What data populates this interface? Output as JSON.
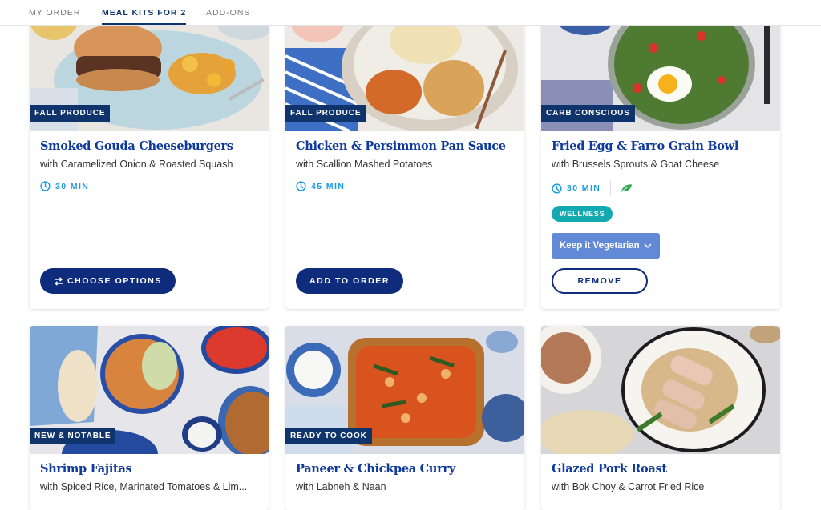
{
  "nav": {
    "tabs": [
      {
        "label": "MY ORDER",
        "active": false
      },
      {
        "label": "MEAL KITS FOR 2",
        "active": true
      },
      {
        "label": "ADD-ONS",
        "active": false
      }
    ]
  },
  "colors": {
    "navy": "#0f2c7c",
    "title_blue": "#0f3a9c",
    "time_blue": "#1f9be0",
    "wellness_teal": "#12aab0",
    "select_blue": "#6189d6"
  },
  "recipes": [
    {
      "tag": "FALL PRODUCE",
      "title": "Smoked Gouda Cheeseburgers",
      "subtitle": "with Caramelized Onion & Roasted Squash",
      "time": "30 MIN",
      "action": "CHOOSE OPTIONS",
      "action_icon": "swap-arrows-icon"
    },
    {
      "tag": "FALL PRODUCE",
      "title": "Chicken & Persimmon Pan Sauce",
      "subtitle": "with Scallion Mashed Potatoes",
      "time": "45 MIN",
      "action": "ADD TO ORDER"
    },
    {
      "tag": "CARB CONSCIOUS",
      "title": "Fried Egg & Farro Grain Bowl",
      "subtitle": "with Brussels Sprouts & Goat Cheese",
      "time": "30 MIN",
      "vegetarian_icon": "leaf-icon",
      "badge": "WELLNESS",
      "option_select": "Keep it Vegetarian",
      "action": "REMOVE",
      "selected": true
    },
    {
      "tag": "NEW & NOTABLE",
      "title": "Shrimp Fajitas",
      "subtitle": "with Spiced Rice, Marinated Tomatoes & Lim..."
    },
    {
      "tag": "READY TO COOK",
      "title": "Paneer & Chickpea Curry",
      "subtitle": "with Labneh & Naan"
    },
    {
      "title": "Glazed Pork Roast",
      "subtitle": "with Bok Choy & Carrot Fried Rice"
    }
  ]
}
